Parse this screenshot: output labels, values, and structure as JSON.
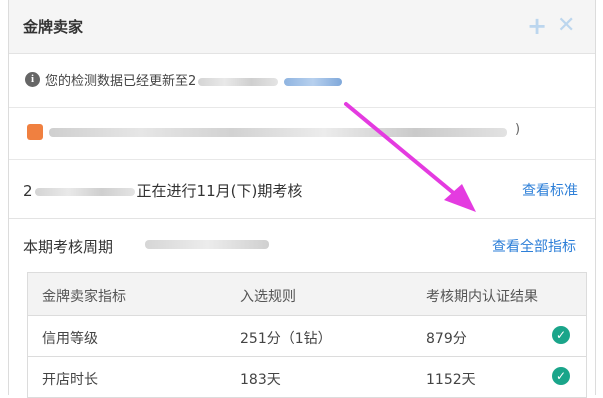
{
  "header": {
    "title": "金牌卖家",
    "add_icon": "plus-icon",
    "close_icon": "close-icon"
  },
  "notice": {
    "text": "您的检测数据已经更新至2",
    "icon": "info-icon"
  },
  "warning": {
    "tail": ")",
    "icon": "warning-icon"
  },
  "period": {
    "prefix": "2",
    "text": "正在进行11月(下)期考核",
    "link": "查看标准"
  },
  "cycle": {
    "label": "本期考核周期",
    "link": "查看全部指标"
  },
  "table": {
    "headers": [
      "金牌卖家指标",
      "入选规则",
      "考核期内认证结果"
    ],
    "rows": [
      {
        "metric": "信用等级",
        "rule": "251分（1钻）",
        "result": "879分",
        "status": "check-icon"
      },
      {
        "metric": "开店时长",
        "rule": "183天",
        "result": "1152天",
        "status": "check-icon"
      }
    ]
  },
  "colors": {
    "accent": "#2d7fd8",
    "arrow": "#e43be0",
    "check": "#1aa58a"
  }
}
